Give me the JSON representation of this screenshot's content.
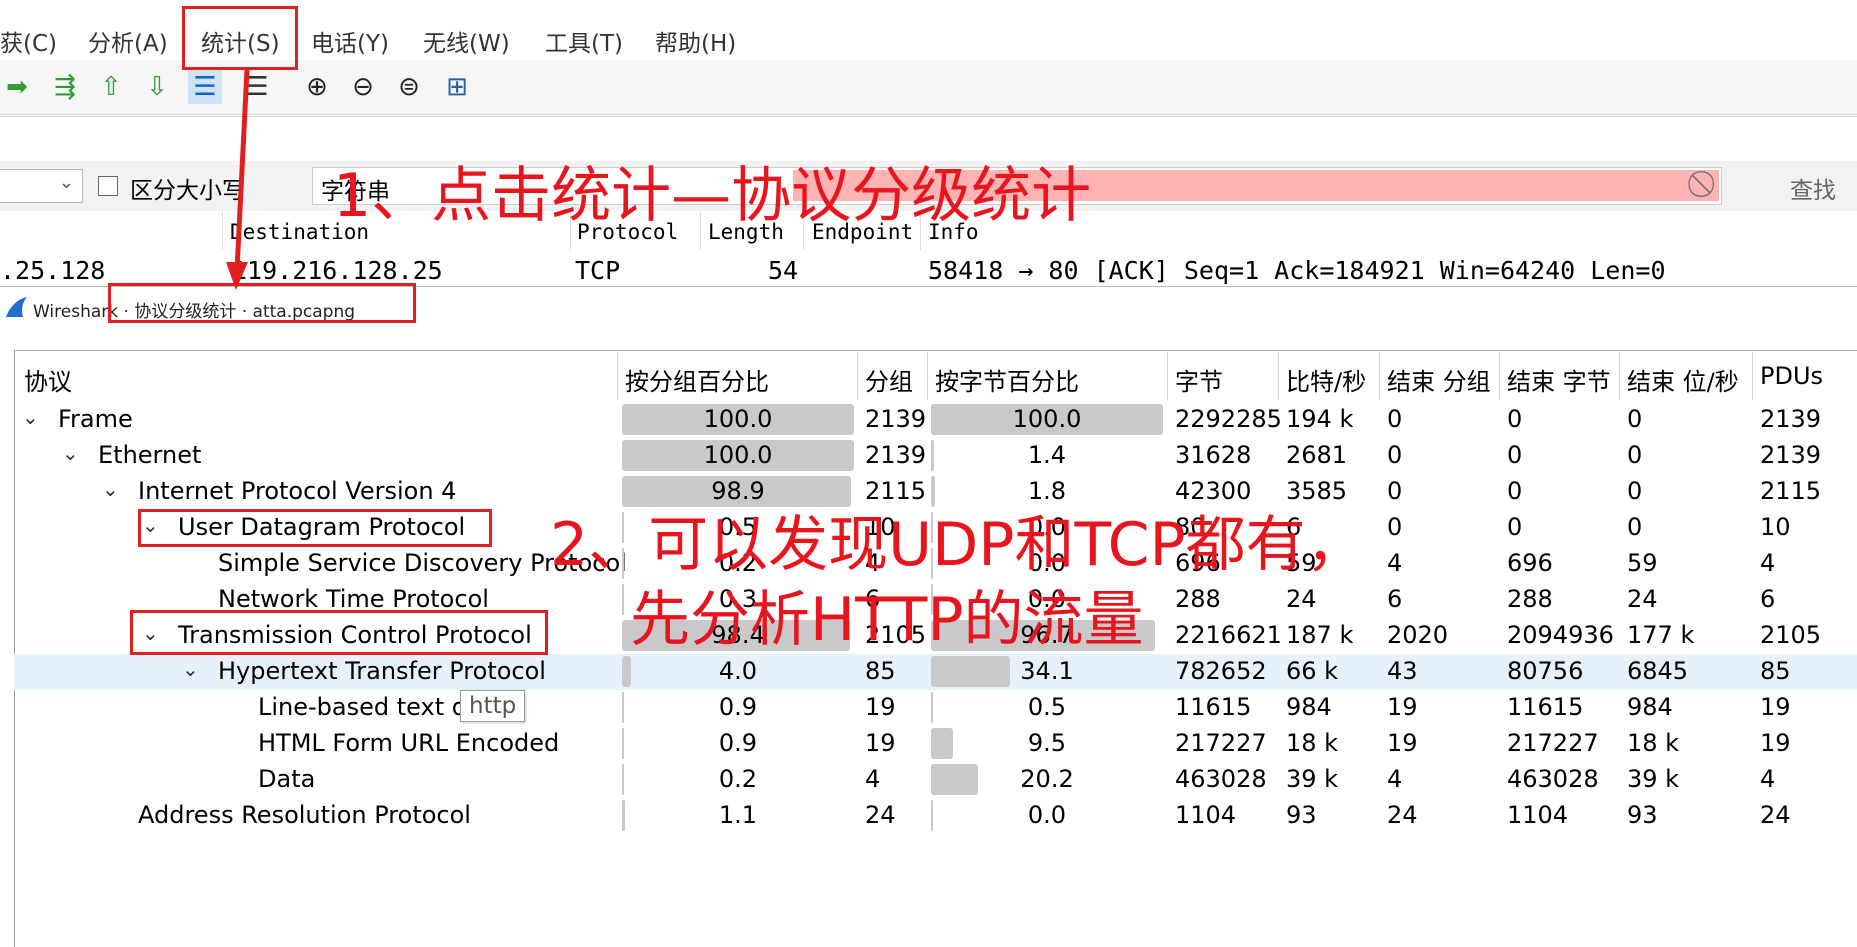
{
  "menu": {
    "items": [
      "获(C)",
      "分析(A)",
      "统计(S)",
      "电话(Y)",
      "无线(W)",
      "工具(T)",
      "帮助(H)"
    ]
  },
  "findbar": {
    "case_label": "区分大小写",
    "search_type": "字符串",
    "find_button": "查找"
  },
  "packet_list": {
    "columns": [
      "Destination",
      "Protocol",
      "Length",
      "Endpoint",
      "Info"
    ],
    "row": {
      "source": ".25.128",
      "destination": "119.216.128.25",
      "protocol": "TCP",
      "length": "54",
      "info": "58418 → 80 [ACK] Seq=1 Ack=184921 Win=64240 Len=0"
    }
  },
  "stats_window": {
    "title": "Wireshark · 协议分级统计 · atta.pcapng",
    "columns": [
      "协议",
      "按分组百分比",
      "分组",
      "按字节百分比",
      "字节",
      "比特/秒",
      "结束 分组",
      "结束 字节",
      "结束 位/秒",
      "PDUs"
    ],
    "rows": [
      {
        "name": "Frame",
        "pct_packets": 100.0,
        "packets": "2139",
        "pct_bytes": 100.0,
        "bytes": "2292285",
        "bps": "194 k",
        "end_packets": "0",
        "end_bytes": "0",
        "end_bps": "0",
        "pdus": "2139",
        "indent": 0,
        "expander": true
      },
      {
        "name": "Ethernet",
        "pct_packets": 100.0,
        "packets": "2139",
        "pct_bytes": 1.4,
        "bytes": "31628",
        "bps": "2681",
        "end_packets": "0",
        "end_bytes": "0",
        "end_bps": "0",
        "pdus": "2139",
        "indent": 1,
        "expander": true
      },
      {
        "name": "Internet Protocol Version 4",
        "pct_packets": 98.9,
        "packets": "2115",
        "pct_bytes": 1.8,
        "bytes": "42300",
        "bps": "3585",
        "end_packets": "0",
        "end_bytes": "0",
        "end_bps": "0",
        "pdus": "2115",
        "indent": 2,
        "expander": true
      },
      {
        "name": "User Datagram Protocol",
        "pct_packets": 0.5,
        "packets": "10",
        "pct_bytes": 0.0,
        "bytes": "80",
        "bps": "6",
        "end_packets": "0",
        "end_bytes": "0",
        "end_bps": "0",
        "pdus": "10",
        "indent": 3,
        "expander": true
      },
      {
        "name": "Simple Service Discovery Protocol",
        "pct_packets": 0.2,
        "packets": "4",
        "pct_bytes": 0.0,
        "bytes": "696",
        "bps": "59",
        "end_packets": "4",
        "end_bytes": "696",
        "end_bps": "59",
        "pdus": "4",
        "indent": 4,
        "expander": false
      },
      {
        "name": "Network Time Protocol",
        "pct_packets": 0.3,
        "packets": "6",
        "pct_bytes": 0.0,
        "bytes": "288",
        "bps": "24",
        "end_packets": "6",
        "end_bytes": "288",
        "end_bps": "24",
        "pdus": "6",
        "indent": 4,
        "expander": false
      },
      {
        "name": "Transmission Control Protocol",
        "pct_packets": 98.4,
        "packets": "2105",
        "pct_bytes": 96.7,
        "bytes": "2216621",
        "bps": "187 k",
        "end_packets": "2020",
        "end_bytes": "2094936",
        "end_bps": "177 k",
        "pdus": "2105",
        "indent": 3,
        "expander": true
      },
      {
        "name": "Hypertext Transfer Protocol",
        "pct_packets": 4.0,
        "packets": "85",
        "pct_bytes": 34.1,
        "bytes": "782652",
        "bps": "66 k",
        "end_packets": "43",
        "end_bytes": "80756",
        "end_bps": "6845",
        "pdus": "85",
        "indent": 4,
        "expander": true,
        "selected": true
      },
      {
        "name": "Line-based text d",
        "pct_packets": 0.9,
        "packets": "19",
        "pct_bytes": 0.5,
        "bytes": "11615",
        "bps": "984",
        "end_packets": "19",
        "end_bytes": "11615",
        "end_bps": "984",
        "pdus": "19",
        "indent": 5,
        "expander": false
      },
      {
        "name": "HTML Form URL Encoded",
        "pct_packets": 0.9,
        "packets": "19",
        "pct_bytes": 9.5,
        "bytes": "217227",
        "bps": "18 k",
        "end_packets": "19",
        "end_bytes": "217227",
        "end_bps": "18 k",
        "pdus": "19",
        "indent": 5,
        "expander": false
      },
      {
        "name": "Data",
        "pct_packets": 0.2,
        "packets": "4",
        "pct_bytes": 20.2,
        "bytes": "463028",
        "bps": "39 k",
        "end_packets": "4",
        "end_bytes": "463028",
        "end_bps": "39 k",
        "pdus": "4",
        "indent": 5,
        "expander": false
      },
      {
        "name": "Address Resolution Protocol",
        "pct_packets": 1.1,
        "packets": "24",
        "pct_bytes": 0.0,
        "bytes": "1104",
        "bps": "93",
        "end_packets": "24",
        "end_bytes": "1104",
        "end_bps": "93",
        "pdus": "24",
        "indent": 2,
        "expander": false
      }
    ],
    "tooltip": "http"
  },
  "annotations": {
    "step1": "1、点击统计—协议分级统计",
    "step2_line1": "2、可以发现UDP和TCP都有，",
    "step2_line2": "先分析HTTP的流量",
    "color": "#e8141e"
  }
}
